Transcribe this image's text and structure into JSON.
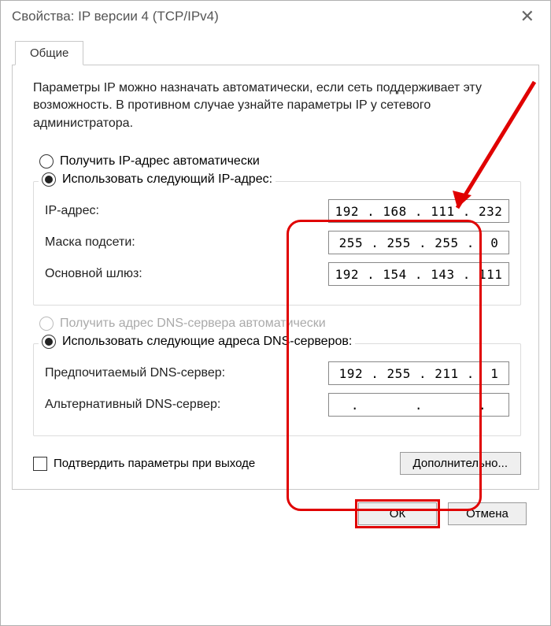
{
  "window": {
    "title": "Свойства: IP версии 4 (TCP/IPv4)"
  },
  "tab": {
    "label": "Общие"
  },
  "intro": "Параметры IP можно назначать автоматически, если сеть поддерживает эту возможность. В противном случае узнайте параметры IP у сетевого администратора.",
  "ip_section": {
    "auto_label": "Получить IP-адрес автоматически",
    "manual_label": "Использовать следующий IP-адрес:",
    "selected": "manual",
    "fields": {
      "ip_label": "IP-адрес:",
      "ip_value": "192 . 168 . 111 . 232",
      "mask_label": "Маска подсети:",
      "mask_value": "255 . 255 . 255 .  0",
      "gw_label": "Основной шлюз:",
      "gw_value": "192 . 154 . 143 . 111"
    }
  },
  "dns_section": {
    "auto_label": "Получить адрес DNS-сервера автоматически",
    "auto_enabled": false,
    "manual_label": "Использовать следующие адреса DNS-серверов:",
    "selected": "manual",
    "fields": {
      "pref_label": "Предпочитаемый DNS-сервер:",
      "pref_value": "192 . 255 . 211 .  1",
      "alt_label": "Альтернативный DNS-сервер:",
      "alt_value": "     .       .       .     "
    }
  },
  "confirm_exit": {
    "label": "Подтвердить параметры при выходе",
    "checked": false
  },
  "buttons": {
    "advanced": "Дополнительно...",
    "ok": "ОК",
    "cancel": "Отмена"
  }
}
